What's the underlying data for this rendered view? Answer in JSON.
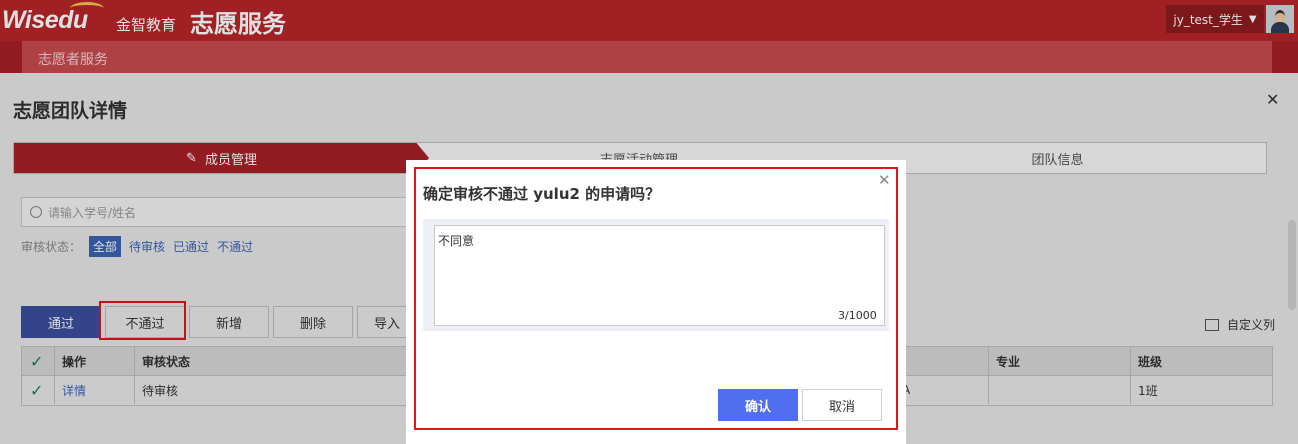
{
  "header": {
    "logo_en": "Wisedu",
    "logo_cn": "金智教育",
    "app_title": "志愿服务",
    "user": "jy_test_学生"
  },
  "subnav": {
    "label": "志愿者服务"
  },
  "page": {
    "title": "志愿团队详情"
  },
  "steps": [
    {
      "label": "成员管理"
    },
    {
      "label": "志愿活动管理"
    },
    {
      "label": "团队信息"
    }
  ],
  "search": {
    "placeholder": "请输入学号/姓名"
  },
  "filter": {
    "label": "审核状态：",
    "options": [
      "全部",
      "待审核",
      "已通过",
      "不通过"
    ]
  },
  "toolbar": {
    "pass": "通过",
    "reject": "不通过",
    "add": "新增",
    "delete": "删除",
    "import": "导入",
    "custom_columns": "自定义列"
  },
  "table": {
    "headers": [
      "操作",
      "审核状态",
      "专业",
      "班级"
    ],
    "rows": [
      {
        "action": "详情",
        "status": "待审核",
        "col_a": "A",
        "major": "",
        "class": "1班"
      }
    ]
  },
  "dialog": {
    "title": "确定审核不通过 yulu2 的申请吗？",
    "textarea_value": "不同意",
    "counter": "3/1000",
    "confirm": "确认",
    "cancel": "取消"
  },
  "colors": {
    "brand_red": "#b8252a",
    "primary_blue": "#4f6ef0",
    "highlight_red": "#e0161b"
  }
}
